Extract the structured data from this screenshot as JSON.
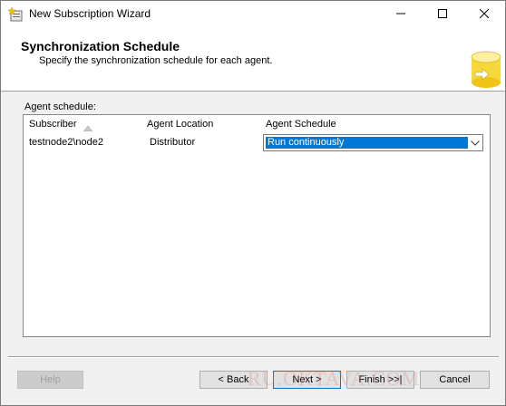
{
  "window": {
    "title": "New Subscription Wizard",
    "icons": {
      "app": "wizard-app-icon",
      "minimize": "minimize-icon",
      "maximize": "maximize-icon",
      "close": "close-icon"
    }
  },
  "header": {
    "title": "Synchronization Schedule",
    "subtitle": "Specify the synchronization schedule for each agent.",
    "icon": "database-sync-icon"
  },
  "agent_schedule": {
    "label": "Agent schedule:",
    "columns": [
      "Subscriber",
      "Agent Location",
      "Agent Schedule"
    ],
    "sort_column": "Subscriber",
    "rows": [
      {
        "subscriber": "testnode2\\node2",
        "location": "Distributor",
        "schedule": "Run continuously"
      }
    ]
  },
  "buttons": {
    "help": "Help",
    "back": "< Back",
    "next": "Next >",
    "finish": "Finish >>|",
    "cancel": "Cancel"
  },
  "watermark": "RU.OKTAVA.COM",
  "colors": {
    "selection": "#0078d7",
    "accent_icon": "#f7d83c"
  }
}
